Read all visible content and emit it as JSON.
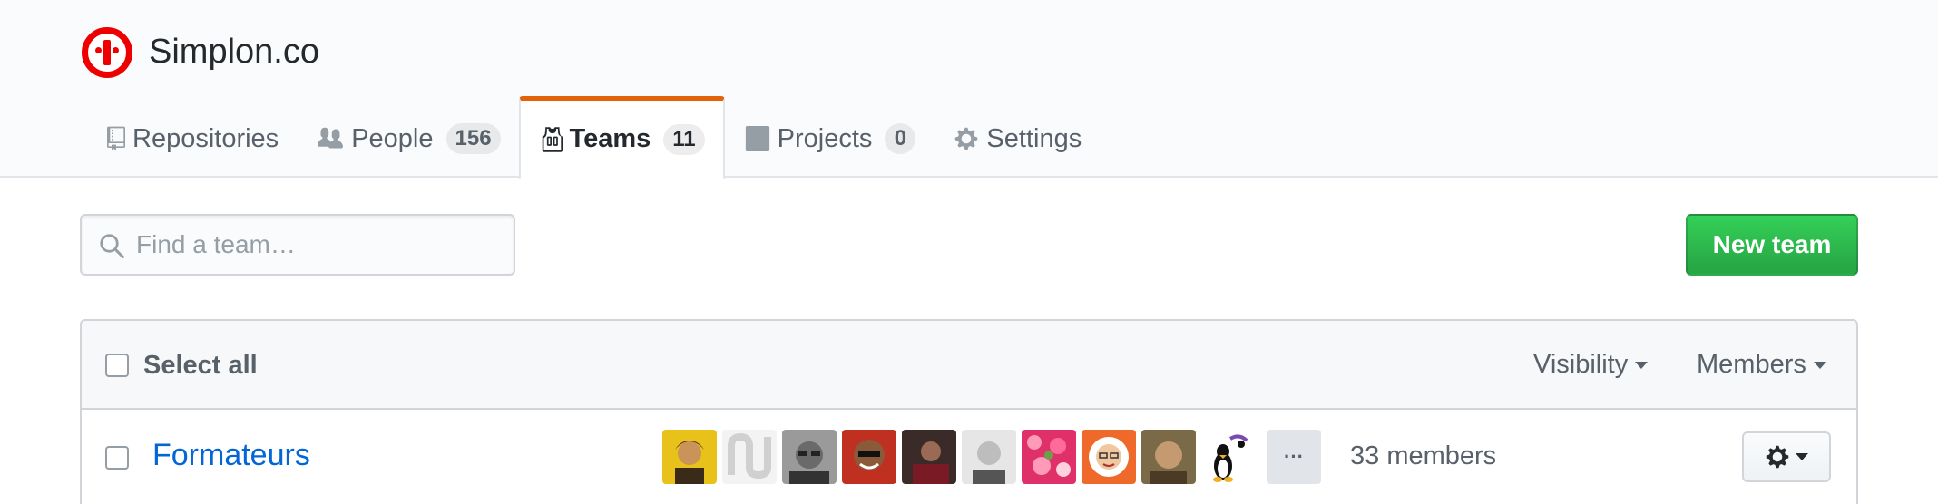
{
  "org": {
    "name": "Simplon.co",
    "logo_icon": "simplon-logo",
    "brand_color": "#ee0000"
  },
  "tabs": [
    {
      "label": "Repositories",
      "icon": "repo-icon",
      "counter": ""
    },
    {
      "label": "People",
      "icon": "people-icon",
      "counter": "156"
    },
    {
      "label": "Teams",
      "icon": "jersey-icon",
      "counter": "11",
      "selected": true
    },
    {
      "label": "Projects",
      "icon": "project-icon",
      "counter": "0"
    },
    {
      "label": "Settings",
      "icon": "gear-icon",
      "counter": ""
    }
  ],
  "search": {
    "placeholder": "Find a team…",
    "value": ""
  },
  "new_team_label": "New team",
  "table": {
    "select_all_label": "Select all",
    "filters": {
      "visibility": "Visibility",
      "members": "Members"
    },
    "rows": [
      {
        "name": "Formateurs",
        "members_text": "33 members",
        "more_avatars": "···"
      }
    ]
  },
  "colors": {
    "accent_tab": "#e36209",
    "link": "#0366d6",
    "primary_button": "#28a745"
  }
}
